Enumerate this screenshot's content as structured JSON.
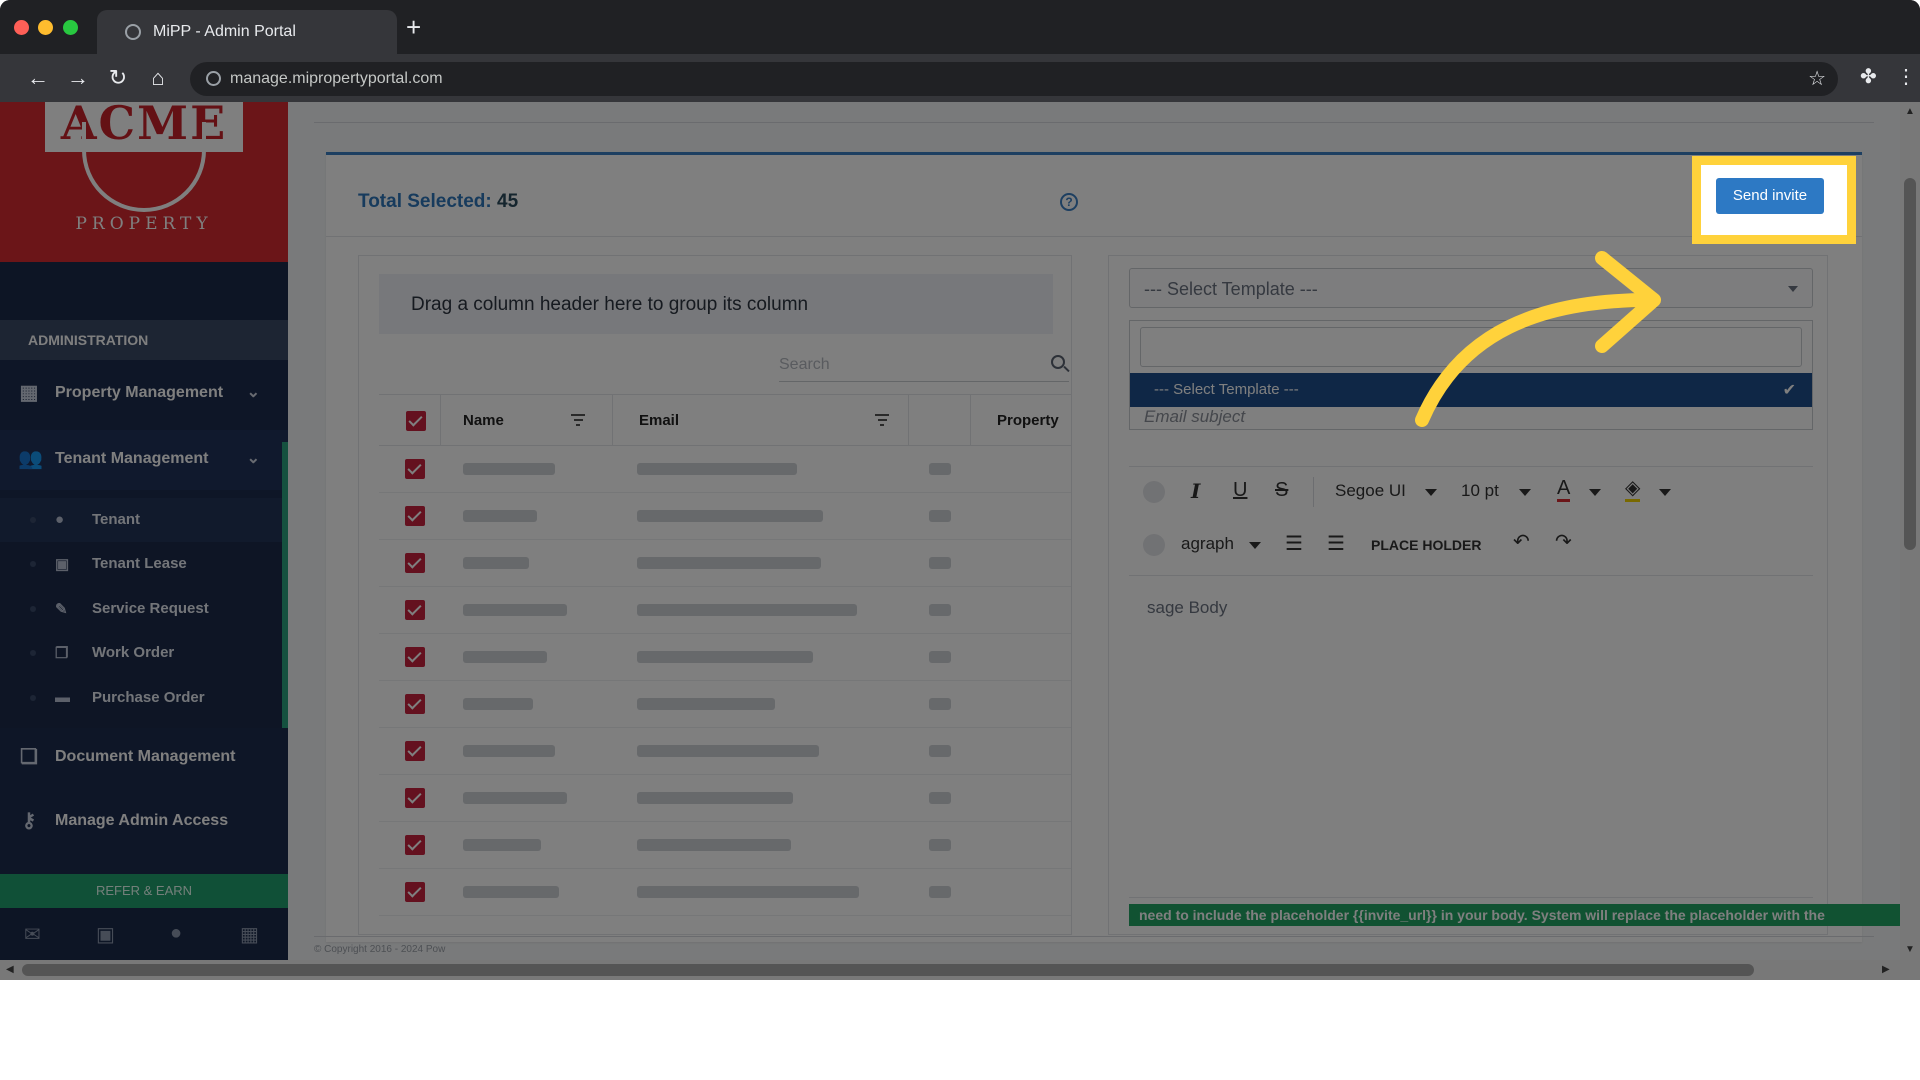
{
  "browser": {
    "tab_title": "MiPP - Admin Portal",
    "url": "manage.mipropertyportal.com"
  },
  "sidebar": {
    "logo_text": "ACME",
    "logo_sub": "PROPERTY",
    "section_header": "ADMINISTRATION",
    "items": [
      {
        "label": "Property Management"
      },
      {
        "label": "Tenant Management"
      },
      {
        "label": "Document Management"
      },
      {
        "label": "Manage Admin Access"
      }
    ],
    "sub_items": [
      {
        "label": "Tenant"
      },
      {
        "label": "Tenant Lease"
      },
      {
        "label": "Service Request"
      },
      {
        "label": "Work Order"
      },
      {
        "label": "Purchase Order"
      }
    ],
    "refer_label": "REFER & EARN"
  },
  "panel": {
    "total_label": "Total Selected:",
    "total_value": "45",
    "help_glyph": "?",
    "send_label": "Send invite"
  },
  "grid": {
    "group_hint": "Drag a column header here to group its column",
    "search_placeholder": "Search",
    "columns": [
      "Name",
      "Email",
      "",
      "Property"
    ],
    "rows_checked": 10
  },
  "editor": {
    "template_placeholder": "--- Select Template ---",
    "template_option": "--- Select Template ---",
    "email_subject_placeholder": "Email subject",
    "font_name": "Segoe UI",
    "font_size": "10 pt",
    "paragraph_label": "agraph",
    "placeholder_button": "PLACE HOLDER",
    "body_placeholder": "sage Body",
    "note": "need to include the placeholder {{invite_url}} in your body. System will replace the placeholder with the"
  },
  "footer": {
    "copyright": "© Copyright 2016 - 2024 Pow"
  },
  "colors": {
    "accent": "#2d79c4",
    "brand_red": "#d62b30",
    "sidebar_bg": "#1d2d4e",
    "highlight": "#ffd23b",
    "check": "#c8233f",
    "success": "#23a565"
  }
}
